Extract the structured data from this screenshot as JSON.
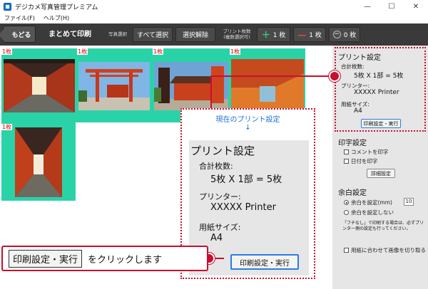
{
  "window": {
    "title": "デジカメ写真管理プレミアム",
    "controls": [
      "—",
      "☐",
      "✕"
    ]
  },
  "menu": [
    "ファイル(F)",
    "ヘルプ(H)"
  ],
  "toolbar": {
    "back_label": "もどる",
    "title": "まとめて印刷",
    "photo_select_label": "写真選択",
    "select_all_label": "すべて選択",
    "deselect_label": "選択解除",
    "print_count_label_line1": "プリント枚数",
    "print_count_label_line2": "(複数選択可)",
    "plus_label": "1 枚",
    "minus_label": "1 枚",
    "zero_label": "0 枚"
  },
  "photos": {
    "count_tag": "1枚"
  },
  "print_settings": {
    "heading": "プリント設定",
    "total_label": "合計枚数:",
    "total_value": "5枚 X 1部 = 5枚",
    "printer_label": "プリンター:",
    "printer_value": "XXXXX Printer",
    "paper_label": "用紙サイズ:",
    "paper_value": "A4",
    "button_label": "印刷設定・実行"
  },
  "stamp_settings": {
    "heading": "印字設定",
    "comment_label": "コメントを印字",
    "date_label": "日付を印字",
    "detail_button": "詳細設定"
  },
  "margin_settings": {
    "heading": "余白設定",
    "option_set": "余白を設定(mm)",
    "spin_value": "10",
    "option_none": "余白を設定しない",
    "note": "「フチなし」で印刷する場合は、必ずプリンター側の設定も行ってください。",
    "fit_label": "用紙に合わせて画像を切り取る"
  },
  "callout": {
    "caption": "現在のプリント設定",
    "arrow": "↓",
    "instruction_tag": "印刷設定・実行",
    "instruction_text": "をクリックします"
  },
  "colors": {
    "annotation": "#c8102e",
    "tile_background": "#2ad3a7",
    "caption_blue": "#1a6fd8"
  }
}
